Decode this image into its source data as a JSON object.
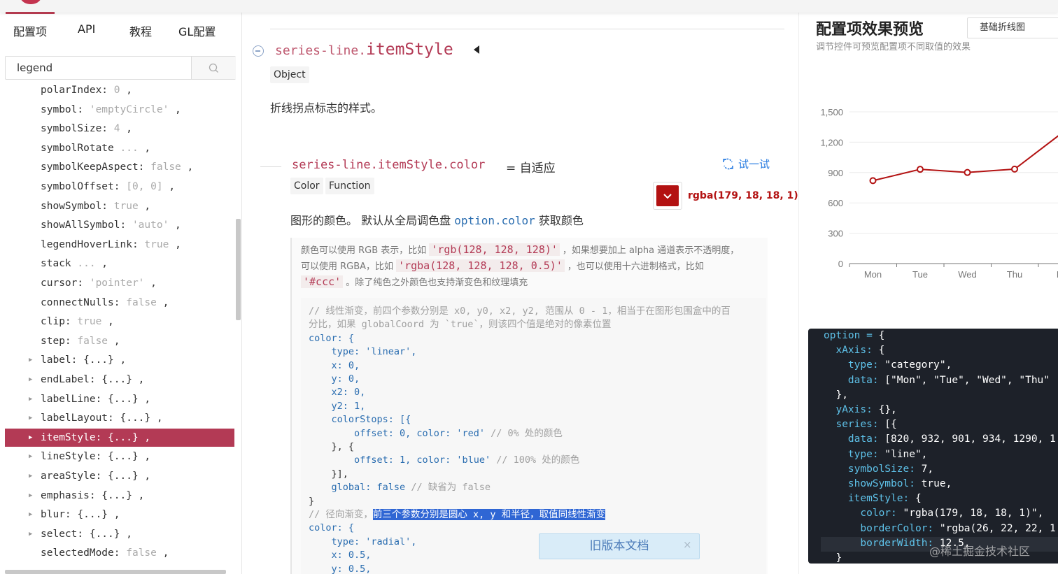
{
  "nav": {
    "tabs": [
      "配置项",
      "API",
      "教程",
      "GL配置"
    ]
  },
  "search": {
    "value": "legend"
  },
  "tree": [
    {
      "key": "polarIndex:",
      "value": "0",
      "vtype": "num",
      "suffix": ",",
      "expandable": false
    },
    {
      "key": "symbol:",
      "value": "'emptyCircle'",
      "vtype": "str",
      "suffix": ",",
      "expandable": false
    },
    {
      "key": "symbolSize:",
      "value": "4",
      "vtype": "num",
      "suffix": ",",
      "expandable": false
    },
    {
      "key": "symbolRotate",
      "value": "...",
      "vtype": "num",
      "suffix": ",",
      "expandable": false
    },
    {
      "key": "symbolKeepAspect:",
      "value": "false",
      "vtype": "bool",
      "suffix": ",",
      "expandable": false
    },
    {
      "key": "symbolOffset:",
      "value": "[0, 0]",
      "vtype": "arr",
      "suffix": ",",
      "expandable": false
    },
    {
      "key": "showSymbol:",
      "value": "true",
      "vtype": "bool",
      "suffix": ",",
      "expandable": false
    },
    {
      "key": "showAllSymbol:",
      "value": "'auto'",
      "vtype": "str",
      "suffix": ",",
      "expandable": false
    },
    {
      "key": "legendHoverLink:",
      "value": "true",
      "vtype": "bool",
      "suffix": ",",
      "expandable": false
    },
    {
      "key": "stack",
      "value": "...",
      "vtype": "num",
      "suffix": ",",
      "expandable": false
    },
    {
      "key": "cursor:",
      "value": "'pointer'",
      "vtype": "str",
      "suffix": ",",
      "expandable": false
    },
    {
      "key": "connectNulls:",
      "value": "false",
      "vtype": "bool",
      "suffix": ",",
      "expandable": false
    },
    {
      "key": "clip:",
      "value": "true",
      "vtype": "bool",
      "suffix": ",",
      "expandable": false
    },
    {
      "key": "step:",
      "value": "false",
      "vtype": "bool",
      "suffix": ",",
      "expandable": false
    },
    {
      "key": "label: {...}",
      "value": "",
      "vtype": "",
      "suffix": ",",
      "expandable": true
    },
    {
      "key": "endLabel: {...}",
      "value": "",
      "vtype": "",
      "suffix": ",",
      "expandable": true
    },
    {
      "key": "labelLine: {...}",
      "value": "",
      "vtype": "",
      "suffix": ",",
      "expandable": true
    },
    {
      "key": "labelLayout: {...}",
      "value": "",
      "vtype": "",
      "suffix": ",",
      "expandable": true
    },
    {
      "key": "itemStyle: {...}",
      "value": "",
      "vtype": "",
      "suffix": ",",
      "expandable": true,
      "selected": true
    },
    {
      "key": "lineStyle: {...}",
      "value": "",
      "vtype": "",
      "suffix": ",",
      "expandable": true
    },
    {
      "key": "areaStyle: {...}",
      "value": "",
      "vtype": "",
      "suffix": ",",
      "expandable": true
    },
    {
      "key": "emphasis: {...}",
      "value": "",
      "vtype": "",
      "suffix": ",",
      "expandable": true
    },
    {
      "key": "blur: {...}",
      "value": "",
      "vtype": "",
      "suffix": ",",
      "expandable": true
    },
    {
      "key": "select: {...}",
      "value": "",
      "vtype": "",
      "suffix": ",",
      "expandable": true
    },
    {
      "key": "selectedMode:",
      "value": "false",
      "vtype": "bool",
      "suffix": ",",
      "expandable": false
    }
  ],
  "doc": {
    "prefix": "series-line.",
    "name": "itemStyle",
    "type": "Object",
    "description": "折线拐点标志的样式。",
    "sub": {
      "prefix": "series-line.itemStyle.",
      "name": "color",
      "default": "= 自适应",
      "types": [
        "Color",
        "Function"
      ],
      "try_label": "试一试",
      "color_value": "rgba(179, 18, 18, 1)",
      "desc_before": "图形的颜色。 默认从全局调色盘 ",
      "desc_code": "option.color",
      "desc_after": " 获取颜色"
    },
    "note": {
      "l1a": "颜色可以使用 RGB 表示，比如",
      "l1code": "'rgb(128, 128, 128)'",
      "l1b": "，如果想要加上 alpha 通道表示不透明度，",
      "l2a": "可以使用 RGBA，比如",
      "l2code": "'rgba(128, 128, 128, 0.5)'",
      "l2b": "，也可以使用十六进制格式，比如",
      "l3code": "'#ccc'",
      "l3b": "。除了纯色之外颜色也支持渐变色和纹理填充"
    },
    "code": {
      "c1": "// 线性渐变，前四个参数分别是 x0, y0, x2, y2, 范围从 0 - 1，相当于在图形包围盒中的百",
      "c2": "分比，如果 globalCoord 为 `true`，则该四个值是绝对的像素位置",
      "l3": "color: {",
      "l4": "    type: 'linear',",
      "l5": "    x: 0,",
      "l6": "    y: 0,",
      "l7": "    x2: 0,",
      "l8": "    y2: 1,",
      "l9": "    colorStops: [{",
      "l10a": "        offset: 0, color: 'red' ",
      "l10c": "// 0% 处的颜色",
      "l11": "    }, {",
      "l12a": "        offset: 1, color: 'blue' ",
      "l12c": "// 100% 处的颜色",
      "l13": "    }],",
      "l14a": "    global: false ",
      "l14c": "// 缺省为 false",
      "l15": "}",
      "l16a": "// 径向渐变，",
      "l16h": "前三个参数分别是圆心 x, y 和半径，取值同线性渐变",
      "l17": "color: {",
      "l18": "    type: 'radial',",
      "l19": "    x: 0.5,",
      "l20": "    y: 0.5,"
    },
    "old_docs": "旧版本文档",
    "old_close": "×"
  },
  "preview": {
    "title": "配置项效果预览",
    "subtitle": "调节控件可预览配置项不同取值的效果",
    "example": "基础折线图",
    "code": [
      "option = {",
      "  xAxis: {",
      "    type: \"category\",",
      "    data: [\"Mon\", \"Tue\", \"Wed\", \"Thu\"",
      "  },",
      "  yAxis: {},",
      "  series: [{",
      "    data: [820, 932, 901, 934, 1290, 1",
      "    type: \"line\",",
      "    symbolSize: 7,",
      "    showSymbol: true,",
      "    itemStyle: {",
      "      color: \"rgba(179, 18, 18, 1)\",",
      "      borderColor: \"rgba(26, 22, 22, 1",
      "      borderWidth: 12.5,",
      "  }"
    ]
  },
  "chart_data": {
    "type": "line",
    "categories": [
      "Mon",
      "Tue",
      "Wed",
      "Thu",
      "Fri"
    ],
    "series": [
      {
        "values": [
          820,
          932,
          901,
          934,
          1290
        ],
        "color": "#b31212"
      }
    ],
    "y_ticks": [
      "0",
      "300",
      "600",
      "900",
      "1,200",
      "1,500"
    ],
    "ylim": [
      0,
      1500
    ],
    "grid": true
  },
  "watermark": "@稀土掘金技术社区",
  "colors": {
    "accent": "#b33a55",
    "link": "#2a7de1",
    "swatch": "#b31212"
  }
}
